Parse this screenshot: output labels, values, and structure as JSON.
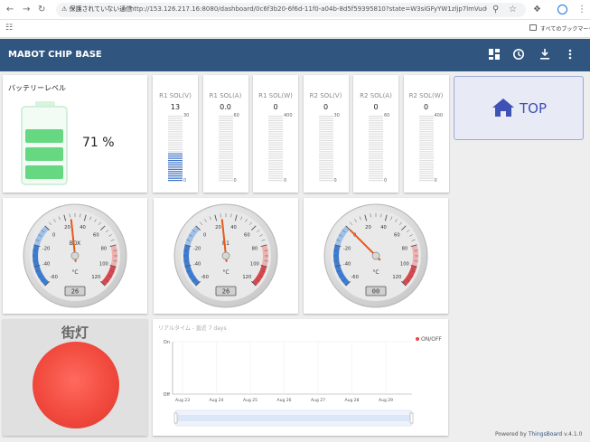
{
  "browser": {
    "security_warning": "保護されていない通信",
    "url": "http://153.126.217.16:8080/dashboard/0c6f3b20-6f6d-11f0-a04b-8d5f59395810?state=W3siGFyYW1zljp7lmVudGl0e...",
    "bookmarks_label": "すべてのブックマーク"
  },
  "header": {
    "title": "MABOT CHIP BASE"
  },
  "battery": {
    "label": "バッテリーレベル",
    "value": "71 %",
    "level_percent": 71
  },
  "bars": [
    {
      "label": "R1 SOL(V)",
      "value": "13",
      "max": "30",
      "min": "0",
      "fill_fraction": 0.43
    },
    {
      "label": "R1 SOL(A)",
      "value": "0.0",
      "max": "60",
      "min": "0",
      "fill_fraction": 0
    },
    {
      "label": "R1 SOL(W)",
      "value": "0",
      "max": "400",
      "min": "0",
      "fill_fraction": 0
    },
    {
      "label": "R2 SOL(V)",
      "value": "0",
      "max": "30",
      "min": "0",
      "fill_fraction": 0
    },
    {
      "label": "R2 SOL(A)",
      "value": "0",
      "max": "60",
      "min": "0",
      "fill_fraction": 0
    },
    {
      "label": "R2 SOL(W)",
      "value": "0",
      "max": "400",
      "min": "0",
      "fill_fraction": 0
    }
  ],
  "top_button": {
    "label": "TOP",
    "color": "#3f51b5"
  },
  "gauge_ticks": [
    "-60",
    "-40",
    "-20",
    "0",
    "20",
    "40",
    "60",
    "80",
    "100",
    "120"
  ],
  "gauges": [
    {
      "title": "BOX",
      "unit": "°C",
      "display": "26",
      "value": 26
    },
    {
      "title": "R1",
      "unit": "°C",
      "display": "26",
      "value": 26
    },
    {
      "title": "",
      "unit": "°C",
      "display": "00",
      "value": 0
    }
  ],
  "streetlight": {
    "label": "街灯",
    "color": "#f44336"
  },
  "timeseries": {
    "title": "リアルタイム - 直近 7 days",
    "legend": "ON/OFF",
    "legend_color": "#f44336",
    "y_ticks": [
      "On",
      "Off"
    ],
    "x_ticks": [
      "Aug 23",
      "Aug 24",
      "Aug 25",
      "Aug 26",
      "Aug 27",
      "Aug 28",
      "Aug 29"
    ]
  },
  "footer": {
    "powered_by": "Powered by",
    "link": "ThingsBoard",
    "version": "v.4.1.0"
  }
}
